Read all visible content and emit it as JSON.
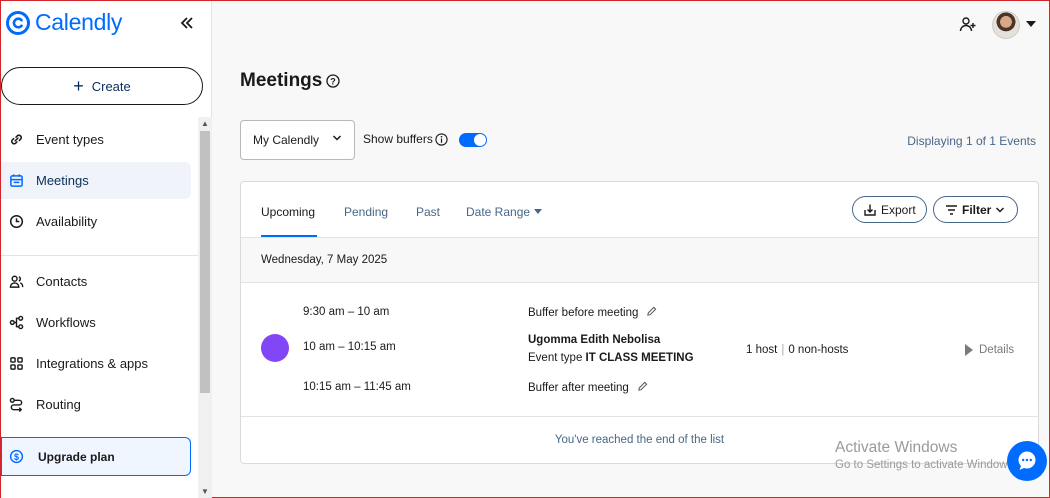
{
  "brand": {
    "name": "Calendly",
    "color": "#006bff"
  },
  "sidebar": {
    "create_label": "Create",
    "items": [
      {
        "label": "Event types",
        "icon": "link-icon"
      },
      {
        "label": "Meetings",
        "icon": "calendar-icon",
        "active": true
      },
      {
        "label": "Availability",
        "icon": "clock-icon"
      },
      {
        "label": "Contacts",
        "icon": "contacts-icon"
      },
      {
        "label": "Workflows",
        "icon": "workflow-icon"
      },
      {
        "label": "Integrations & apps",
        "icon": "grid-icon"
      },
      {
        "label": "Routing",
        "icon": "routing-icon"
      }
    ],
    "upgrade_label": "Upgrade plan"
  },
  "header": {
    "title": "Meetings"
  },
  "controls": {
    "calendar_select": "My Calendly",
    "show_buffers_label": "Show buffers",
    "show_buffers_on": true,
    "displaying": "Displaying 1 of 1 Events"
  },
  "tabs": [
    {
      "label": "Upcoming",
      "active": true
    },
    {
      "label": "Pending"
    },
    {
      "label": "Past"
    },
    {
      "label": "Date Range"
    }
  ],
  "actions": {
    "export_label": "Export",
    "filter_label": "Filter"
  },
  "date_heading": "Wednesday, 7 May 2025",
  "event": {
    "color": "#8247f5",
    "buffer_before_time": "9:30 am – 10 am",
    "buffer_before_label": "Buffer before meeting",
    "time": "10 am – 10:15 am",
    "invitee": "Ugomma Edith Nebolisa",
    "event_type_prefix": "Event type",
    "event_type": "IT CLASS MEETING",
    "buffer_after_time": "10:15 am – 11:45 am",
    "buffer_after_label": "Buffer after meeting",
    "hosts": "1 host",
    "non_hosts": "0 non-hosts",
    "details_label": "Details"
  },
  "end_of_list": "You've reached the end of the list",
  "watermark": {
    "line1": "Activate Windows",
    "line2": "Go to Settings to activate Windows."
  }
}
